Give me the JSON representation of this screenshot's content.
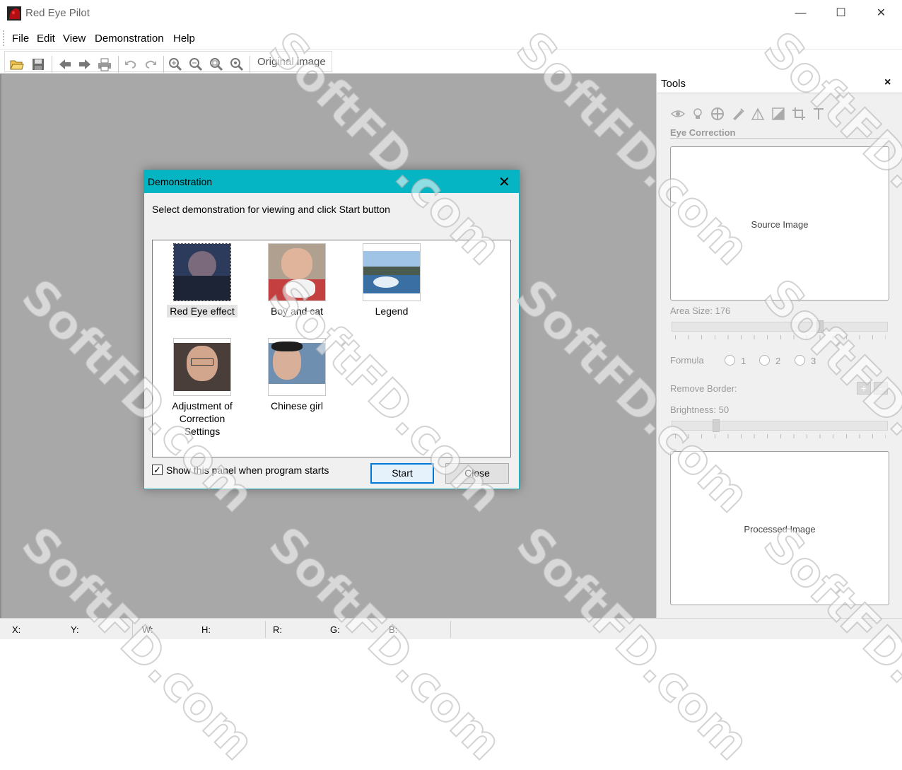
{
  "window": {
    "title": "Red Eye Pilot",
    "minimize": "—",
    "maximize": "☐",
    "close": "✕"
  },
  "menu": [
    "File",
    "Edit",
    "View",
    "Demonstration",
    "Help"
  ],
  "toolbar": {
    "icons": [
      "open-folder",
      "save",
      "back-arrow",
      "forward-arrow",
      "print",
      "undo",
      "redo",
      "zoom-in",
      "zoom-out",
      "zoom-fit",
      "zoom-actual"
    ],
    "original_image_label": "Original image"
  },
  "tools": {
    "title": "Tools",
    "close": "×",
    "section": "Eye Correction",
    "icons": [
      "eye",
      "bulb",
      "color-wheel",
      "brush",
      "levels",
      "contrast",
      "crop",
      "text"
    ],
    "source_label": "Source Image",
    "area_size_label": "Area Size: 176",
    "area_size": 176,
    "formula_label": "Formula",
    "formula_options": [
      "1",
      "2",
      "3"
    ],
    "remove_border_label": "Remove Border:",
    "remove_border_plus": "+",
    "remove_border_minus": "-",
    "brightness_label": "Brightness: 50",
    "brightness": 50,
    "processed_label": "Processed Image"
  },
  "dialog": {
    "title": "Demonstration",
    "close": "✕",
    "instruction": "Select demonstration for viewing and click Start button",
    "items": [
      {
        "label": "Red Eye effect",
        "selected": true
      },
      {
        "label": "Boy and cat",
        "selected": false
      },
      {
        "label": "Legend",
        "selected": false
      },
      {
        "label": "Adjustment of Correction Settings",
        "selected": false
      },
      {
        "label": "Chinese girl",
        "selected": false
      }
    ],
    "checkbox_label": "Show this panel when program starts",
    "checkbox_checked": true,
    "checkbox_mark": "✓",
    "start": "Start",
    "close_button": "Close"
  },
  "status": {
    "x": "X:",
    "y": "Y:",
    "w": "W:",
    "h": "H:",
    "r": "R:",
    "g": "G:",
    "b": "B:"
  },
  "watermark": "SoftFD.com",
  "colors": {
    "dialog_title_bar": "#05b5c3",
    "workspace": "#a8a8a8",
    "focus": "#0078d7"
  }
}
